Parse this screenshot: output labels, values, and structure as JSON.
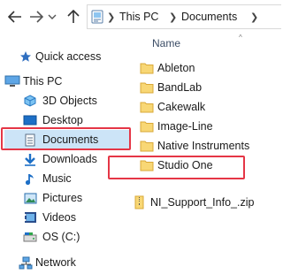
{
  "toolbar": {
    "back_icon": "arrow-left-icon",
    "forward_icon": "arrow-right-icon",
    "recent_icon": "chevron-down-icon",
    "up_icon": "arrow-up-icon",
    "breadcrumb": [
      "This PC",
      "Documents"
    ]
  },
  "nav": {
    "items": [
      {
        "label": "Quick access",
        "icon": "star-icon"
      },
      {
        "label": "This PC",
        "icon": "computer-icon"
      },
      {
        "label": "3D Objects",
        "icon": "cube-icon"
      },
      {
        "label": "Desktop",
        "icon": "desktop-icon"
      },
      {
        "label": "Documents",
        "icon": "document-icon"
      },
      {
        "label": "Downloads",
        "icon": "download-icon"
      },
      {
        "label": "Music",
        "icon": "music-icon"
      },
      {
        "label": "Pictures",
        "icon": "picture-icon"
      },
      {
        "label": "Videos",
        "icon": "video-icon"
      },
      {
        "label": "OS (C:)",
        "icon": "drive-icon"
      },
      {
        "label": "Network",
        "icon": "network-icon"
      }
    ],
    "selected": "Documents"
  },
  "files": {
    "column_header": "Name",
    "sort_indicator": "^",
    "rows": [
      {
        "name": "Ableton",
        "type": "folder"
      },
      {
        "name": "BandLab",
        "type": "folder"
      },
      {
        "name": "Cakewalk",
        "type": "folder"
      },
      {
        "name": "Image-Line",
        "type": "folder"
      },
      {
        "name": "Native Instruments",
        "type": "folder"
      },
      {
        "name": "Studio One",
        "type": "folder"
      },
      {
        "name": "NI_Support_Info_.zip",
        "type": "zip"
      }
    ]
  },
  "colors": {
    "highlight": "#e53646",
    "selection": "#cce4f7",
    "folder": "#f8d775",
    "accent": "#1979ca"
  }
}
